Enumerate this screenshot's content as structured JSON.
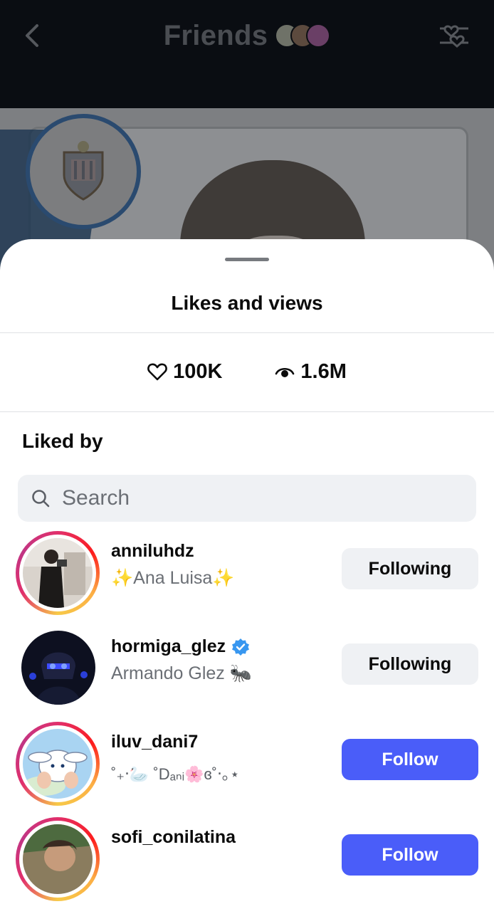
{
  "header": {
    "title": "Friends",
    "back_icon": "chevron-left-icon",
    "filter_icon": "heart-sliders-icon"
  },
  "sheet": {
    "title": "Likes and views",
    "likes": "100K",
    "views": "1.6M",
    "section_title": "Liked by",
    "search_placeholder": "Search"
  },
  "users": [
    {
      "username": "anniluhdz",
      "name_pre": "✨",
      "name": "Ana Luisa",
      "name_post": "✨",
      "button": "Following",
      "verified": false
    },
    {
      "username": "hormiga_glez",
      "name_pre": "",
      "name": "Armando Glez",
      "name_post": " 🐜",
      "button": "Following",
      "verified": true
    },
    {
      "username": "iluv_dani7",
      "name_pre": "",
      "name": "˚₊‧🦢 ˚Dₐₙᵢ🌸ɞ˚‧｡⋆",
      "name_post": "",
      "button": "Follow",
      "verified": false
    },
    {
      "username": "sofi_conilatina",
      "name_pre": "",
      "name": "",
      "name_post": "",
      "button": "Follow",
      "verified": false
    }
  ],
  "colors": {
    "follow_blue": "#4a5df9",
    "following_gray": "#eff1f4",
    "verified_blue": "#3897f0"
  }
}
